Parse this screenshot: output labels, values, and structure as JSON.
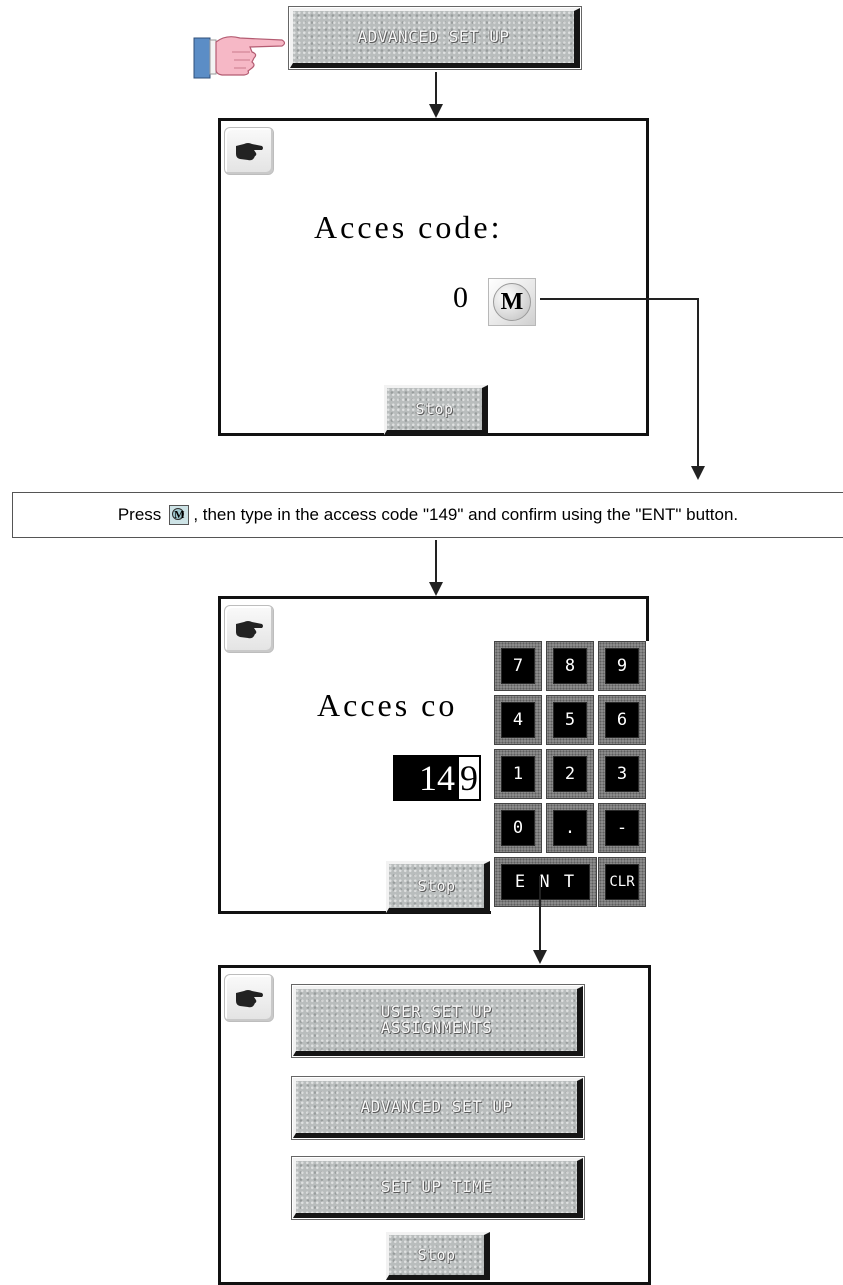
{
  "step1": {
    "button_label": "ADVANCED SET UP"
  },
  "screen1": {
    "label": "Acces code:",
    "value": "0",
    "m_button_label": "M",
    "stop_label": "Stop"
  },
  "instruction": {
    "before": "Press",
    "icon_letter": "M",
    "after": ", then type in the access code \"149\" and confirm using the \"ENT\" button."
  },
  "screen2": {
    "label": "Acces co",
    "entry_main": "14",
    "entry_cursor": "9",
    "stop_label": "Stop",
    "keys": [
      "7",
      "8",
      "9",
      "4",
      "5",
      "6",
      "1",
      "2",
      "3",
      "0",
      ".",
      "-"
    ],
    "ent_label": "E N T",
    "clr_label": "CLR"
  },
  "screen3": {
    "menu": {
      "user_setup_line1": "USER SET UP",
      "user_setup_line2": "ASSIGNMENTS",
      "advanced_setup": "ADVANCED SET UP",
      "setup_time": "SET UP TIME"
    },
    "stop_label": "Stop"
  },
  "icons": {
    "pointing_hand": "pointing-hand-icon",
    "back": "back-hand-icon"
  }
}
